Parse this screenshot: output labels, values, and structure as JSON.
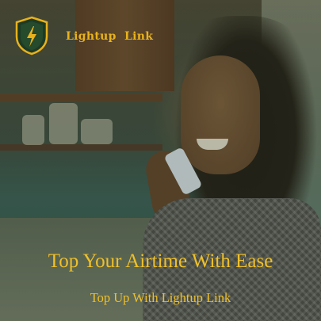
{
  "brand": {
    "name": "Lightup  Link",
    "logo_icon": "shield-lightning-icon",
    "accent_color": "#e8b21c"
  },
  "hero": {
    "headline": "Top Your Airtime With Ease",
    "subheadline": "Top Up With Lightup Link",
    "text_color": "#f0c02a",
    "photo": "woman-talking-on-phone-image"
  }
}
